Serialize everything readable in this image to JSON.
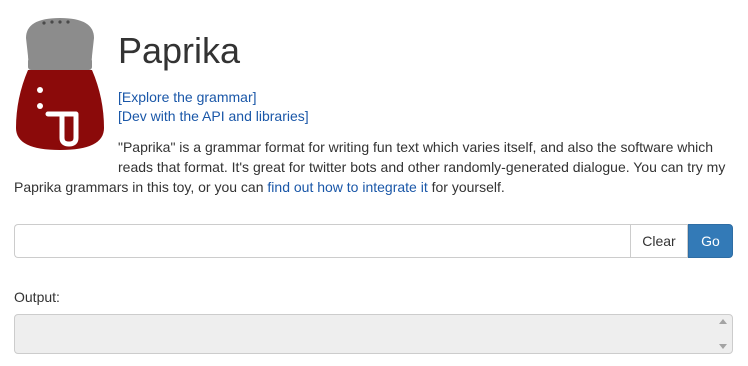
{
  "header": {
    "title": "Paprika",
    "logo_icon": "paprika-shaker-icon"
  },
  "links": {
    "explore": "[Explore the grammar]",
    "dev": "[Dev with the API and libraries]"
  },
  "intro": {
    "text_before_link": "\"Paprika\" is a grammar format for writing fun text which varies itself, and also the software which reads that format. It's great for twitter bots and other randomly-generated dialogue. You can try my Paprika grammars in this toy, or you can ",
    "link_text": "find out how to integrate it",
    "text_after_link": " for yourself."
  },
  "input": {
    "value": "",
    "placeholder": ""
  },
  "buttons": {
    "clear": "Clear",
    "go": "Go"
  },
  "output": {
    "label": "Output:",
    "value": ""
  },
  "colors": {
    "link": "#1a57a8",
    "go_button": "#337ab7",
    "shaker_body": "#8b0a0a",
    "shaker_cap": "#8c8c8c"
  }
}
